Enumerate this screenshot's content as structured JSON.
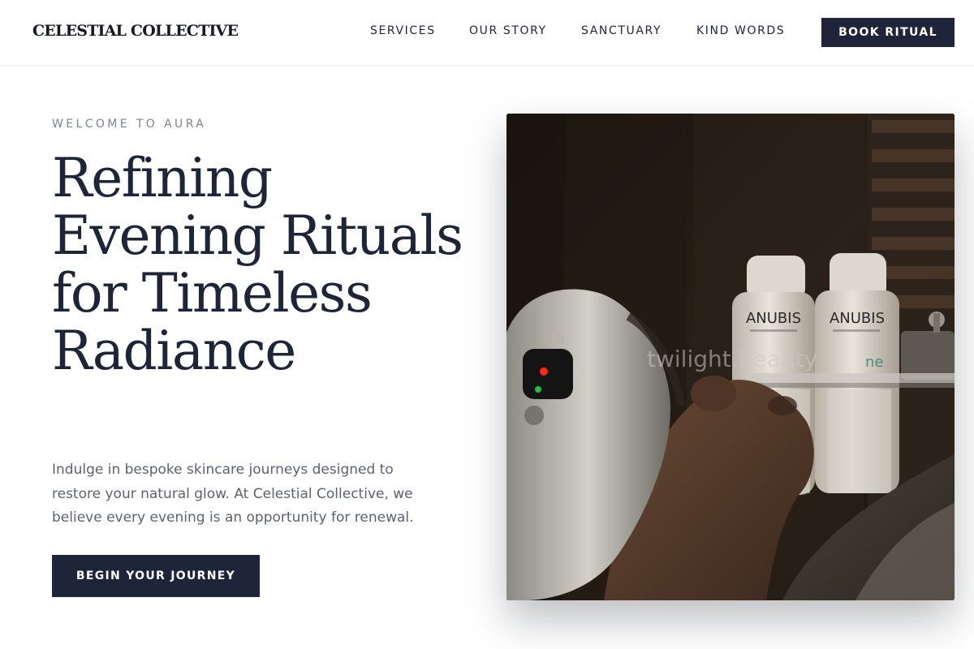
{
  "brand": {
    "name": "Celestial Collective"
  },
  "nav": {
    "links": [
      "SERVICES",
      "OUR STORY",
      "SANCTUARY",
      "KIND WORDS"
    ],
    "cta": "BOOK RITUAL"
  },
  "hero": {
    "eyebrow": "WELCOME TO AURA",
    "headline": "Refining Evening Rituals for Timeless Radiance",
    "body": "Indulge in bespoke skincare journeys designed to restore your natural glow. At Celestial Collective, we believe every evening is an opportunity for renewal.",
    "cta": "BEGIN YOUR JOURNEY"
  },
  "photo": {
    "bottle_brand": "ANUBIS",
    "watermark": "twilight.beauty",
    "shelf_tag": "ne"
  },
  "colors": {
    "navy": "#1e2538",
    "muted_text": "#5b6272",
    "eyebrow": "#7b8290",
    "device_led_red": "#ff2a10",
    "device_led_green": "#21c23a"
  }
}
